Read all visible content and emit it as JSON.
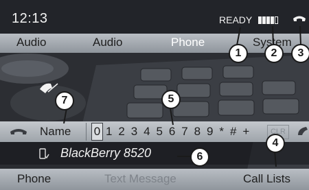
{
  "status": {
    "clock": "12:13",
    "ready": "READY",
    "signal_bars_filled": 4,
    "signal_bars_total": 5
  },
  "main_menu": {
    "items": [
      {
        "label": "Audio"
      },
      {
        "label": "Audio"
      },
      {
        "label": "Phone",
        "active": true
      },
      {
        "label": "System"
      }
    ]
  },
  "entry": {
    "name_label": "Name",
    "selected_char": "0",
    "digits": "1 2 3 4 5 6 7 8 9 * # +",
    "clr_label": "CLR"
  },
  "device": {
    "name": "BlackBerry 8520"
  },
  "bottom_menu": {
    "phone": "Phone",
    "text_message": "Text Message",
    "call_lists": "Call Lists"
  },
  "callouts": [
    "1",
    "2",
    "3",
    "4",
    "5",
    "6",
    "7"
  ],
  "colors": {
    "menu_bar": "#a9aeb4",
    "status_bar": "#222429",
    "active_menu_text": "#ffffff",
    "disabled_text": "#7e838a"
  }
}
